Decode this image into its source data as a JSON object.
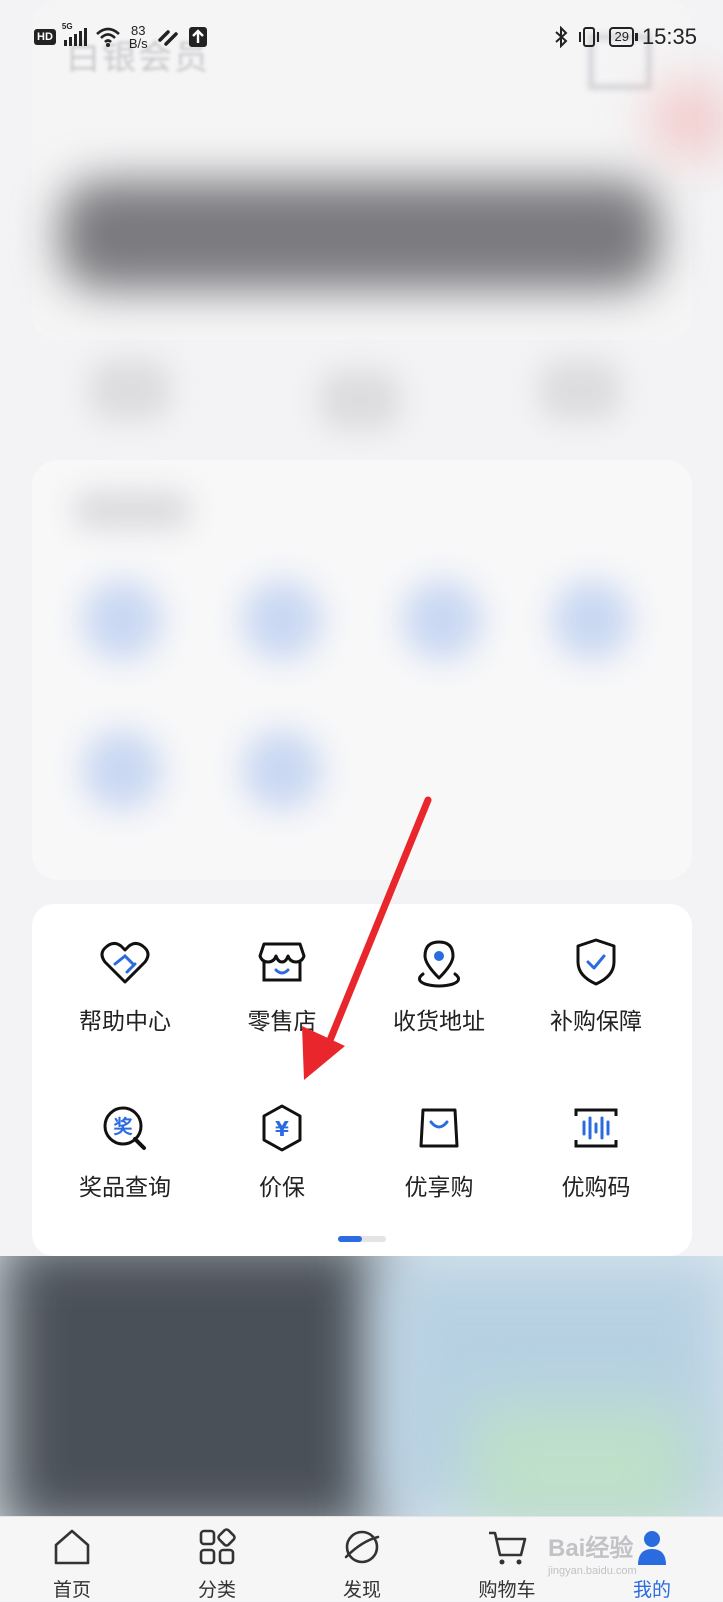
{
  "status_bar": {
    "hd": "HD",
    "network": "5G",
    "wifi_num": "6",
    "speed_value": "83",
    "speed_unit": "B/s",
    "battery": "29",
    "time": "15:35"
  },
  "header": {
    "member_title": "白银会员"
  },
  "tools": {
    "items": [
      {
        "label": "帮助中心",
        "icon": "heart-handshake-icon"
      },
      {
        "label": "零售店",
        "icon": "store-icon"
      },
      {
        "label": "收货地址",
        "icon": "location-pin-icon"
      },
      {
        "label": "补购保障",
        "icon": "shield-check-icon"
      },
      {
        "label": "奖品查询",
        "icon": "prize-search-icon",
        "glyph": "奖"
      },
      {
        "label": "价保",
        "icon": "price-protect-icon",
        "glyph": "¥"
      },
      {
        "label": "优享购",
        "icon": "shopping-bag-icon"
      },
      {
        "label": "优购码",
        "icon": "barcode-icon"
      }
    ],
    "page_indicator": {
      "current": 1,
      "total": 2
    }
  },
  "tabbar": {
    "tabs": [
      {
        "label": "首页",
        "icon": "home-icon"
      },
      {
        "label": "分类",
        "icon": "category-grid-icon"
      },
      {
        "label": "发现",
        "icon": "planet-icon"
      },
      {
        "label": "购物车",
        "icon": "cart-icon"
      },
      {
        "label": "我的",
        "icon": "user-icon",
        "active": true
      }
    ]
  },
  "watermark": {
    "brand": "Bai经验",
    "url": "jingyan.baidu.com"
  },
  "colors": {
    "accent": "#2a6be0",
    "arrow": "#e8262b"
  }
}
